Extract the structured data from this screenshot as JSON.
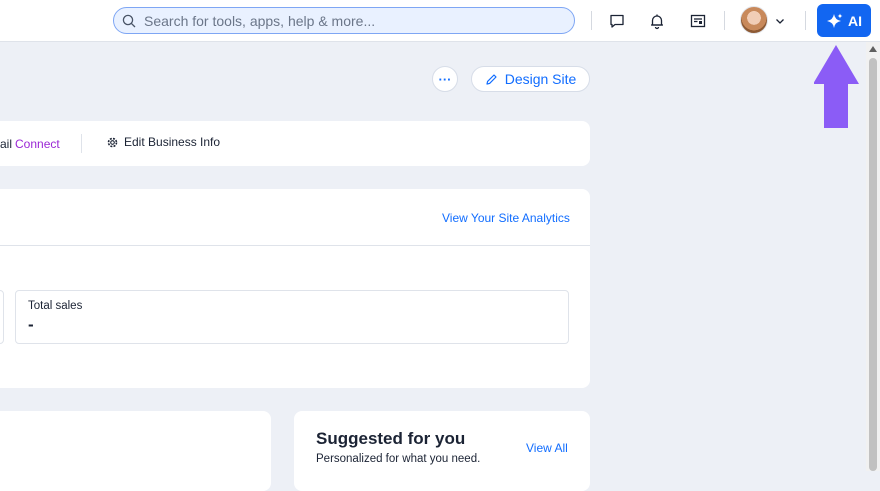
{
  "topbar": {
    "search_placeholder": "Search for tools, apps, help & more...",
    "ai_label": "AI",
    "icons": [
      "search-icon",
      "chat-icon",
      "bell-icon",
      "browser-icon",
      "chevron-down-icon",
      "sparkle-icon"
    ]
  },
  "actions": {
    "more_label": "···",
    "design_label": "Design Site"
  },
  "business_bar": {
    "email_fragment": "ail",
    "connect_label": "Connect",
    "edit_label": "Edit Business Info"
  },
  "analytics": {
    "link_label": "View Your Site Analytics",
    "total_sales_label": "Total sales",
    "total_sales_value": "-"
  },
  "suggested": {
    "title": "Suggested for you",
    "subtitle": "Personalized for what you need.",
    "view_all_label": "View All"
  },
  "colors": {
    "accent": "#116dff",
    "connect": "#9a27d5",
    "annotation_arrow": "#8b5cf6",
    "background": "#edf0f6"
  }
}
